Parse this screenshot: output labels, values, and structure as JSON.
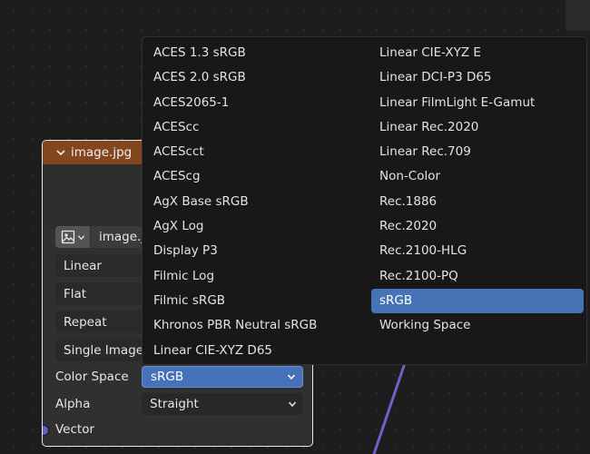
{
  "node": {
    "title": "image.jpg",
    "image_name": "image.jpg",
    "interpolation": "Linear",
    "projection": "Flat",
    "extension": "Repeat",
    "source": "Single Image",
    "color_space_label": "Color Space",
    "color_space_value": "sRGB",
    "alpha_label": "Alpha",
    "alpha_value": "Straight",
    "vector_label": "Vector",
    "colors": {
      "header": "#83461f",
      "selected": "#4572b8",
      "socket": "#6363c7"
    }
  },
  "menu": {
    "left": [
      "ACES 1.3 sRGB",
      "ACES 2.0 sRGB",
      "ACES2065-1",
      "ACEScc",
      "ACEScct",
      "ACEScg",
      "AgX Base sRGB",
      "AgX Log",
      "Display P3",
      "Filmic Log",
      "Filmic sRGB",
      "Khronos PBR Neutral sRGB",
      "Linear CIE-XYZ D65"
    ],
    "right": [
      "Linear CIE-XYZ E",
      "Linear DCI-P3 D65",
      "Linear FilmLight E-Gamut",
      "Linear Rec.2020",
      "Linear Rec.709",
      "Non-Color",
      "Rec.1886",
      "Rec.2020",
      "Rec.2100-HLG",
      "Rec.2100-PQ",
      "sRGB",
      "Working Space"
    ],
    "selected": "sRGB"
  }
}
